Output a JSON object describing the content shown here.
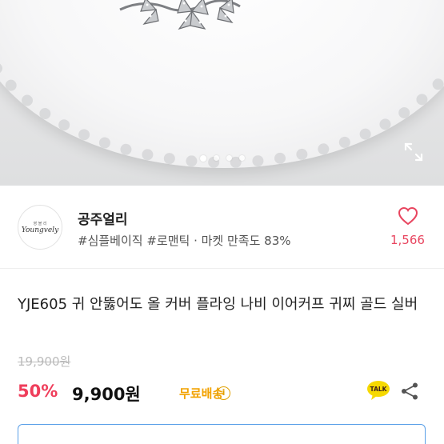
{
  "seller": {
    "name": "공주얼리",
    "logo_small_text": "영 블 리",
    "logo_text": "Youngvely",
    "tags": "#심플베이직 #로맨틱 · 마켓 만족도 83%",
    "like_count": "1,566"
  },
  "product": {
    "title": "YJE605 귀 안뚫어도 올 커버 플라잉 나비 이어커프 귀찌 골드 실버",
    "original_price": "19,900원",
    "discount": "50%",
    "price": "9,900원",
    "shipping": "무료배송",
    "info_icon_glyph": "i"
  },
  "talk_label": "TALK",
  "icons": {
    "expand": "expand-icon",
    "heart": "heart-icon",
    "talk": "kakao-talk-icon",
    "share": "share-icon",
    "info": "info-icon"
  },
  "colors": {
    "accent_red": "#ef3e5b",
    "like_pink": "#e8455f",
    "shipping_orange": "#f2a200",
    "box_blue": "#5aa0e8"
  },
  "carousel": {
    "total": 4,
    "active_index": 0
  }
}
